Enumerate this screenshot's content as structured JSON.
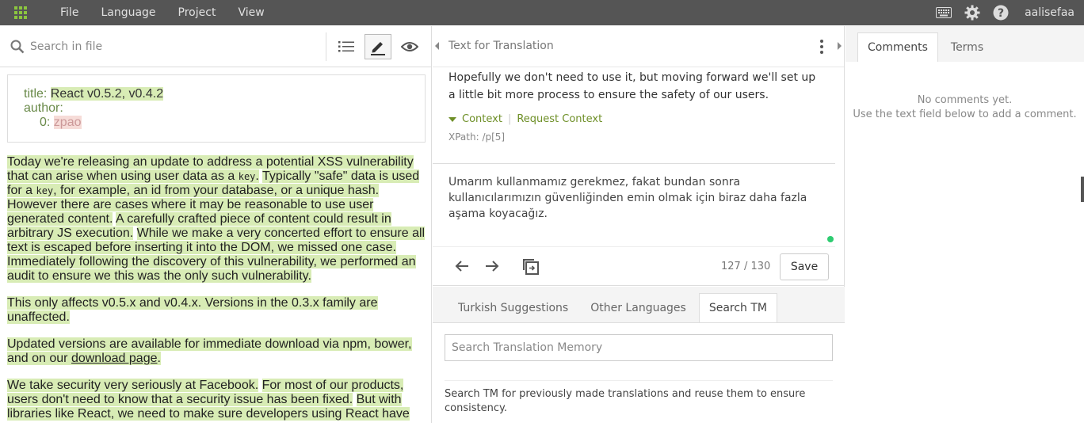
{
  "topbar": {
    "menu": [
      "File",
      "Language",
      "Project",
      "View"
    ],
    "user": "aalisefaa",
    "icons": [
      "apps-grid-icon",
      "keyboard-icon",
      "gear-icon",
      "help-icon"
    ],
    "accent": "#8cc63f"
  },
  "left": {
    "search_placeholder": "Search in file",
    "meta": {
      "title_key": "title:",
      "title_value": "React v0.5.2, v0.4.2",
      "author_key": "author:",
      "author_index": "0:",
      "author_value": "zpao"
    },
    "paragraphs": {
      "p1": {
        "s1": "Today we're releasing an update to address a potential XSS vulnerability that can arise when using user data as a ",
        "code1": "key",
        "s1b": ".",
        "s2": "Typically \"safe\" data is used for a ",
        "code2": "key",
        "s2b": ", for example, an id from your database, or a unique hash.",
        "s3": "However there are cases where it may be reasonable to use user generated content.",
        "s4": "A carefully crafted piece of content could result in arbitrary JS execution.",
        "s5": "While we make a very concerted effort to ensure all text is escaped before inserting it into the DOM, we missed one case.",
        "s6": "Immediately following the discovery of this vulnerability, we performed an audit to ensure we this was the only such vulnerability."
      },
      "p2": "This only affects v0.5.x and v0.4.x. Versions in the 0.3.x family are unaffected.",
      "p3": {
        "text": "Updated versions are available for immediate download via npm, bower, and on our ",
        "link": "download page",
        "end": "."
      },
      "p4": {
        "s1": "We take security very seriously at Facebook.",
        "s2": "For most of our products, users don't need to know that a security issue has been fixed.",
        "s3": "But with libraries like React, we need to make sure developers using React have"
      }
    }
  },
  "middle": {
    "header_title": "Text for Translation",
    "source_text": "Hopefully we don't need to use it, but moving forward we'll set up a little bit more process to ensure the safety of our users.",
    "context_label": "Context",
    "request_context": "Request Context",
    "xpath": "XPath: /p[5]",
    "translation": "Umarım kullanmamız gerekmez, fakat bundan sonra kullanıcılarımızın güvenliğinden emin olmak için biraz daha fazla aşama koyacağız.",
    "char_count": "127 / 130",
    "save_label": "Save",
    "tabs": [
      "Turkish Suggestions",
      "Other Languages",
      "Search TM"
    ],
    "tm_placeholder": "Search Translation Memory",
    "tm_hint": "Search TM for previously made translations and reuse them to ensure consistency."
  },
  "right": {
    "tabs": [
      "Comments",
      "Terms"
    ],
    "no_comments_1": "No comments yet.",
    "no_comments_2": "Use the text field below to add a comment."
  }
}
